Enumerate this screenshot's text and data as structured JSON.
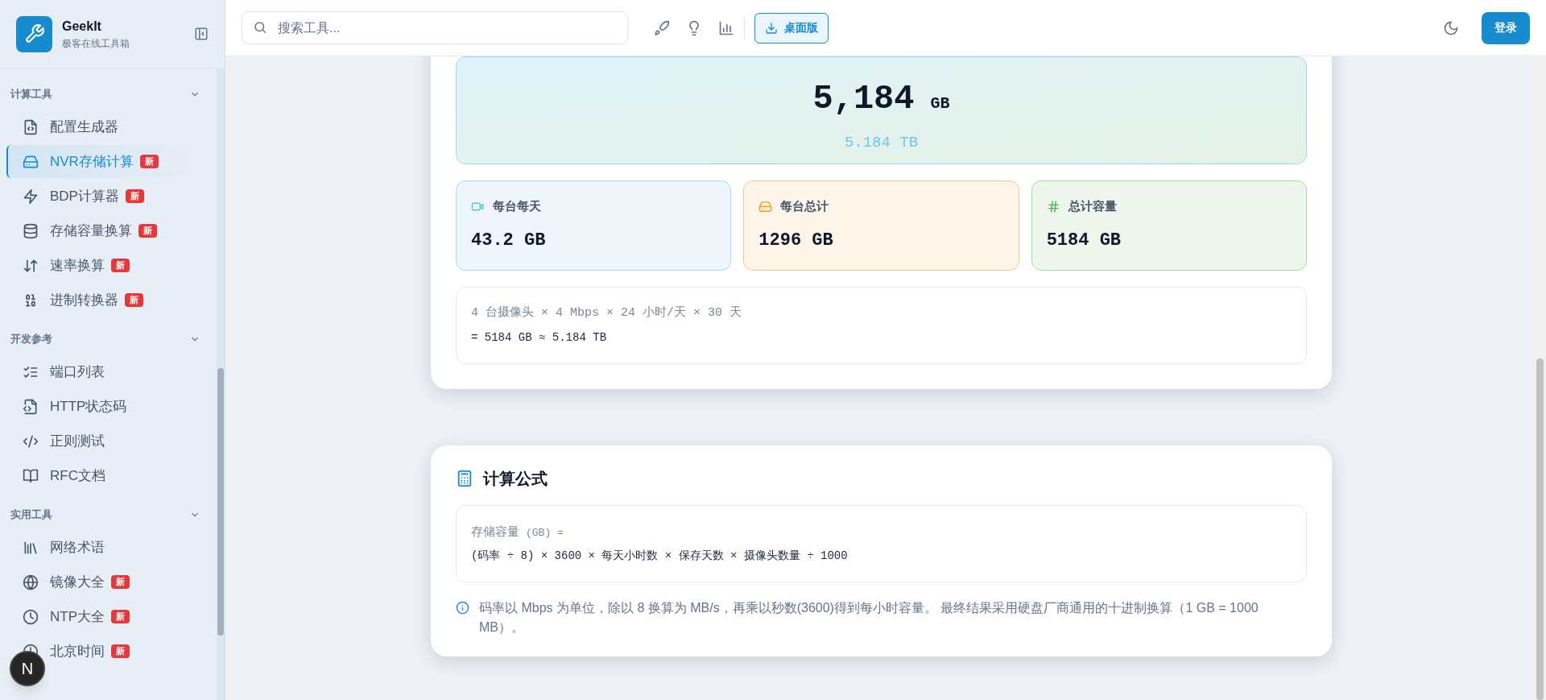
{
  "brand": {
    "name": "GeekIt",
    "tagline": "极客在线工具箱"
  },
  "sidebar": {
    "sections": [
      {
        "title": "计算工具",
        "expanded": true,
        "items": [
          {
            "label": "配置生成器",
            "selected": false
          },
          {
            "label": "NVR存储计算",
            "badge": "新",
            "selected": true
          },
          {
            "label": "BDP计算器",
            "badge": "新",
            "selected": false
          },
          {
            "label": "存储容量换算",
            "badge": "新",
            "selected": false
          },
          {
            "label": "速率换算",
            "badge": "新",
            "selected": false
          },
          {
            "label": "进制转换器",
            "badge": "新",
            "selected": false
          }
        ]
      },
      {
        "title": "开发参考",
        "expanded": true,
        "items": [
          {
            "label": "端口列表",
            "selected": false
          },
          {
            "label": "HTTP状态码",
            "selected": false
          },
          {
            "label": "正则测试",
            "selected": false
          },
          {
            "label": "RFC文档",
            "selected": false
          }
        ]
      },
      {
        "title": "实用工具",
        "expanded": true,
        "items": [
          {
            "label": "网络术语",
            "selected": false
          },
          {
            "label": "镜像大全",
            "badge": "新",
            "selected": false
          },
          {
            "label": "NTP大全",
            "badge": "新",
            "selected": false
          },
          {
            "label": "北京时间",
            "badge": "新",
            "selected": false
          }
        ]
      }
    ]
  },
  "dev_indicator": "N",
  "header": {
    "search": {
      "placeholder": "搜索工具..."
    },
    "desktop_button": "桌面版",
    "login_button": "登录"
  },
  "result": {
    "total": "5,184",
    "total_unit": "GB",
    "total_tb": "5.184 TB",
    "stats": [
      {
        "kind": "camera",
        "label": "每台每天",
        "value": "43.2 GB"
      },
      {
        "kind": "drive",
        "label": "每台总计",
        "value": "1296 GB"
      },
      {
        "kind": "hash",
        "label": "总计容量",
        "value": "5184 GB"
      }
    ],
    "expression": "4 台摄像头 × 4 Mbps × 24 小时/天 × 30 天",
    "equals": "= 5184 GB ≈ 5.184 TB"
  },
  "formula": {
    "title": "计算公式",
    "lhs": "存储容量",
    "lhs_unit": "(GB) =",
    "rhs": "(码率 ÷ 8) × 3600 × 每天小时数 × 保存天数 × 摄像头数量 ÷ 1000",
    "note": "码率以 Mbps 为单位，除以 8 换算为 MB/s，再乘以秒数(3600)得到每小时容量。 最终结果采用硬盘厂商通用的十进制换算（1 GB = 1000 MB）。"
  }
}
